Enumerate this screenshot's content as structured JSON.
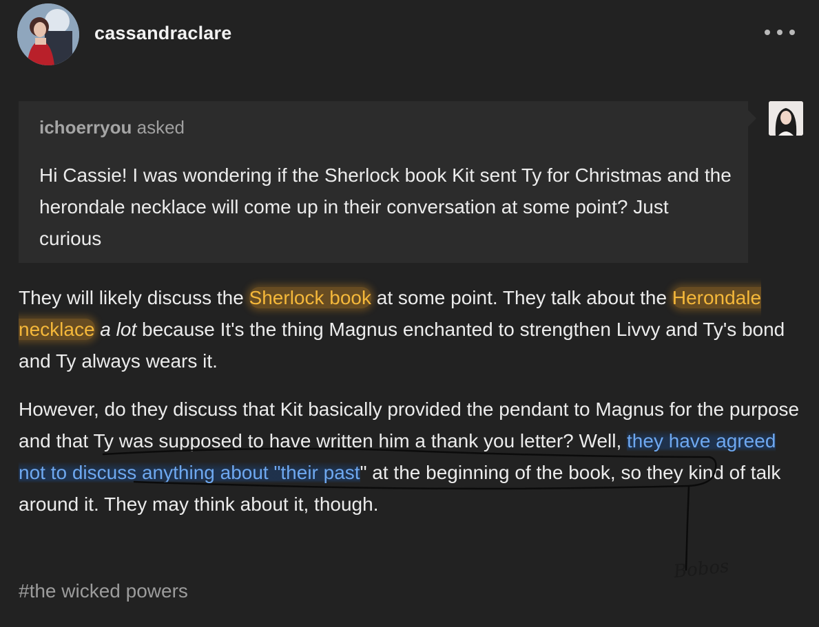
{
  "post": {
    "author": "cassandraclare",
    "more_icon": "ellipsis-icon"
  },
  "ask": {
    "asker": "ichoerryou",
    "asked_label": "asked",
    "question": "Hi Cassie! I was wondering if the Sherlock book Kit sent Ty for Christmas and the herondale necklace will come up in their conversation at some point? Just curious"
  },
  "answer": {
    "p1_part1": "They will likely discuss the ",
    "p1_hl1": "Sherlock book",
    "p1_part2": " at some point. They talk about the ",
    "p1_hl2": "Herondale necklace",
    "p1_part3": " ",
    "p1_em": "a lot",
    "p1_part4": " because It's the thing Magnus enchanted to strengthen Livvy and Ty's bond and Ty always wears it.",
    "p2_part1": "However, do they discuss that Kit basically provided the pendant to Magnus for the purpose and that Ty was supposed to have written him a thank you letter? Well, ",
    "p2_hl": "they have agreed not to discuss anything about \"their past",
    "p2_part2": "\" at the beginning of the book, so they kind of talk around it. They may think about it, though."
  },
  "tags": [
    "#the wicked powers"
  ],
  "annotation": {
    "handwritten_note": "Bobos"
  },
  "colors": {
    "background": "#222222",
    "ask_box": "#2c2c2c",
    "highlight_orange": "#f5b83a",
    "highlight_blue": "#6ea8f0",
    "tag": "#9c9c9c"
  }
}
